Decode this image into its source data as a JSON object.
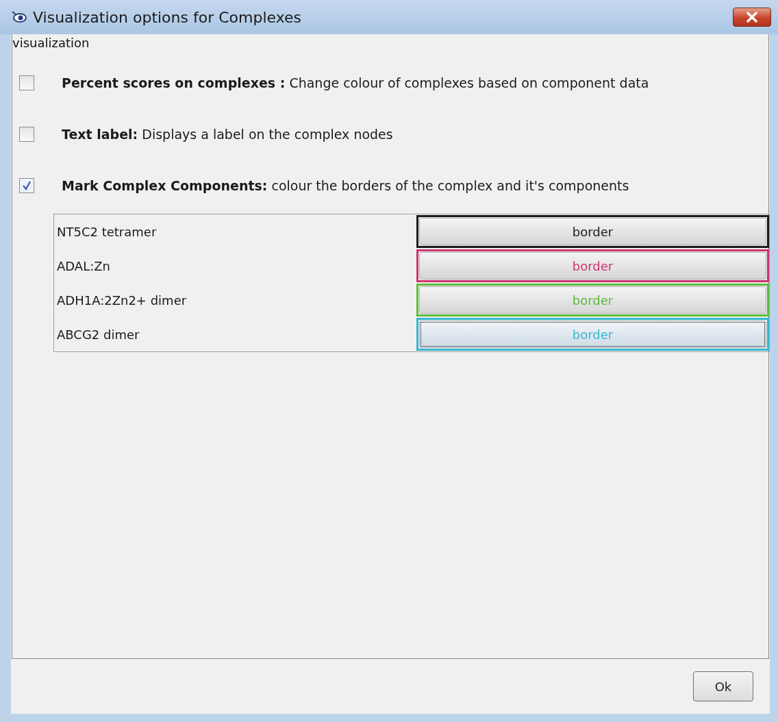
{
  "window": {
    "title": "Visualization options for Complexes"
  },
  "section_label": "visualization",
  "options": [
    {
      "text": "**Percent scores on complexes :** Change colour of complexes based on component data",
      "checked": false
    },
    {
      "text": "**Text label:** Displays a label on the complex nodes",
      "checked": false
    },
    {
      "text": "**Mark Complex Components:** colour the borders of the complex and it's components",
      "checked": true
    }
  ],
  "complexes": [
    {
      "name": "NT5C2 tetramer",
      "button": "border",
      "color": "#1a1a1a",
      "focused": false
    },
    {
      "name": "ADAL:Zn",
      "button": "border",
      "color": "#d0336f",
      "focused": false
    },
    {
      "name": "ADH1A:2Zn2+ dimer",
      "button": "border",
      "color": "#5cbb3a",
      "focused": false
    },
    {
      "name": "ABCG2 dimer",
      "button": "border",
      "color": "#35b8d2",
      "focused": true
    }
  ],
  "buttons": [
    "Ok"
  ]
}
